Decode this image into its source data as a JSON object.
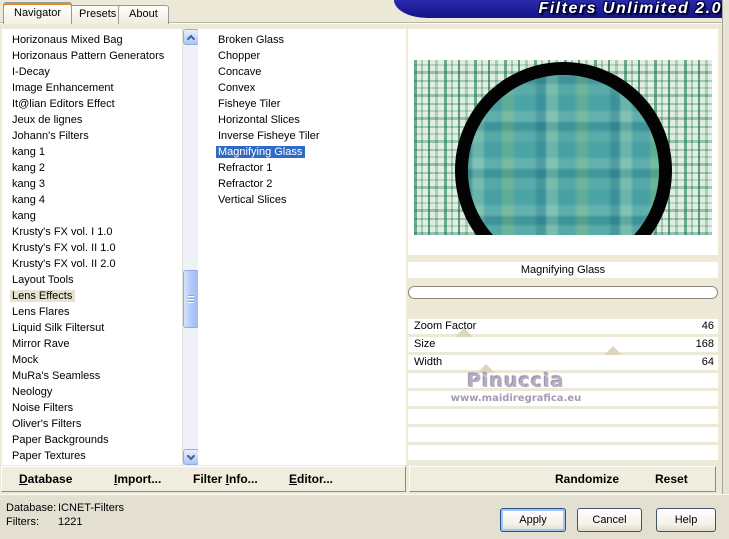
{
  "window": {
    "title": "Filters Unlimited 2.0"
  },
  "tabs": [
    {
      "label": "Navigator",
      "active": true
    },
    {
      "label": "Presets",
      "active": false
    },
    {
      "label": "About",
      "active": false
    }
  ],
  "category_list": {
    "items": [
      "Horizonaus Mixed Bag",
      "Horizonaus Pattern Generators",
      "I-Decay",
      "Image Enhancement",
      "It@lian Editors Effect",
      "Jeux de lignes",
      "Johann's Filters",
      "kang 1",
      "kang 2",
      "kang 3",
      "kang 4",
      "kang",
      "Krusty's FX vol. I 1.0",
      "Krusty's FX vol. II 1.0",
      "Krusty's FX vol. II 2.0",
      "Layout Tools",
      "Lens Effects",
      "Lens Flares",
      "Liquid Silk Filtersut",
      "Mirror Rave",
      "Mock",
      "MuRa's Seamless",
      "Neology",
      "Noise Filters",
      "Oliver's Filters",
      "Paper Backgrounds",
      "Paper Textures"
    ],
    "selected": "Lens Effects"
  },
  "filter_list": {
    "items": [
      "Broken Glass",
      "Chopper",
      "Concave",
      "Convex",
      "Fisheye Tiler",
      "Horizontal Slices",
      "Inverse Fisheye Tiler",
      "Magnifying Glass",
      "Refractor 1",
      "Refractor 2",
      "Vertical Slices"
    ],
    "selected": "Magnifying Glass"
  },
  "preview": {
    "caption": "Magnifying Glass"
  },
  "parameters": [
    {
      "name": "Zoom Factor",
      "value": "46",
      "thumb_pct": 18
    },
    {
      "name": "Size",
      "value": "168",
      "thumb_pct": 66
    },
    {
      "name": "Width",
      "value": "64",
      "thumb_pct": 25
    }
  ],
  "right_panel": {
    "empty_row_count": 5
  },
  "watermark": {
    "line1": "Pinuccia",
    "line2": "www.maidiregrafica.eu"
  },
  "toolbar": {
    "left": [
      {
        "pre": "",
        "mn": "D",
        "post": "atabase"
      },
      {
        "pre": "",
        "mn": "I",
        "post": "mport..."
      },
      {
        "pre": "Filter ",
        "mn": "I",
        "post": "nfo..."
      },
      {
        "pre": "",
        "mn": "E",
        "post": "ditor..."
      }
    ],
    "right": [
      {
        "label": "Randomize"
      },
      {
        "label": "Reset"
      }
    ]
  },
  "status": {
    "database_label": "Database:",
    "database_value": "ICNET-Filters",
    "filters_label": "Filters:",
    "filters_value": "1221"
  },
  "buttons": {
    "apply": "Apply",
    "cancel": "Cancel",
    "help": "Help"
  },
  "colors": {
    "banner_navy": "#13138A",
    "selection_blue": "#316AC5",
    "category_highlight": "#E7E3D0",
    "background_beige": "#ECE9D8"
  }
}
